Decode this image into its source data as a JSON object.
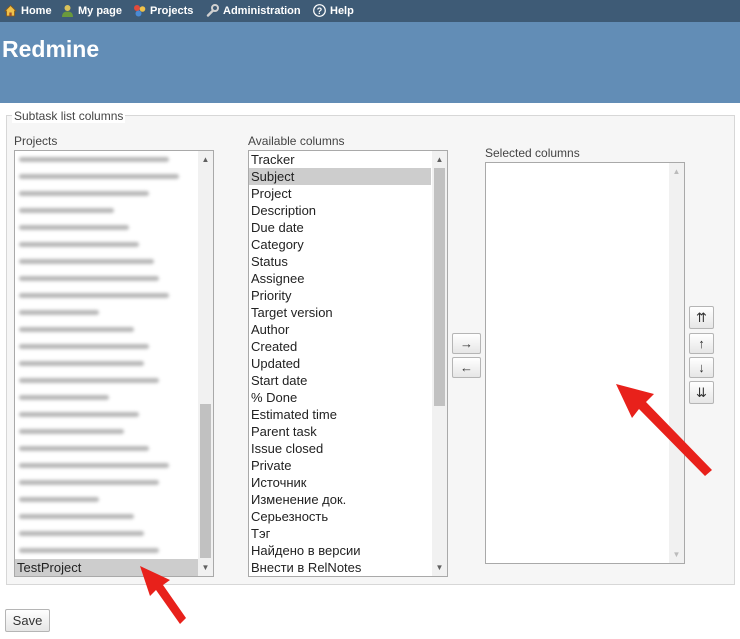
{
  "top_menu": {
    "home": "Home",
    "my_page": "My page",
    "projects": "Projects",
    "administration": "Administration",
    "help": "Help"
  },
  "header": {
    "title": "Redmine"
  },
  "fieldset": {
    "legend": "Subtask list columns"
  },
  "projects": {
    "label": "Projects",
    "last_item": "TestProject"
  },
  "available": {
    "label": "Available columns",
    "items": [
      "Tracker",
      "Subject",
      "Project",
      "Description",
      "Due date",
      "Category",
      "Status",
      "Assignee",
      "Priority",
      "Target version",
      "Author",
      "Created",
      "Updated",
      "Start date",
      "% Done",
      "Estimated time",
      "Parent task",
      "Issue closed",
      "Private",
      "Источник",
      "Изменение док.",
      "Серьезность",
      "Тэг",
      "Найдено в версии",
      "Внести в RelNotes"
    ],
    "selected_item": "Subject"
  },
  "selected": {
    "label": "Selected columns"
  },
  "buttons": {
    "move_right": "→",
    "move_left": "←",
    "top": "⇈",
    "up": "↑",
    "down": "↓",
    "bottom": "⇊",
    "save": "Save"
  },
  "icons": [
    "home-icon",
    "user-icon",
    "projects-icon",
    "wrench-icon",
    "help-icon"
  ],
  "colors": {
    "top_menu": "#3e5b76",
    "header": "#628db6",
    "annotation_arrow": "#e8211b"
  }
}
